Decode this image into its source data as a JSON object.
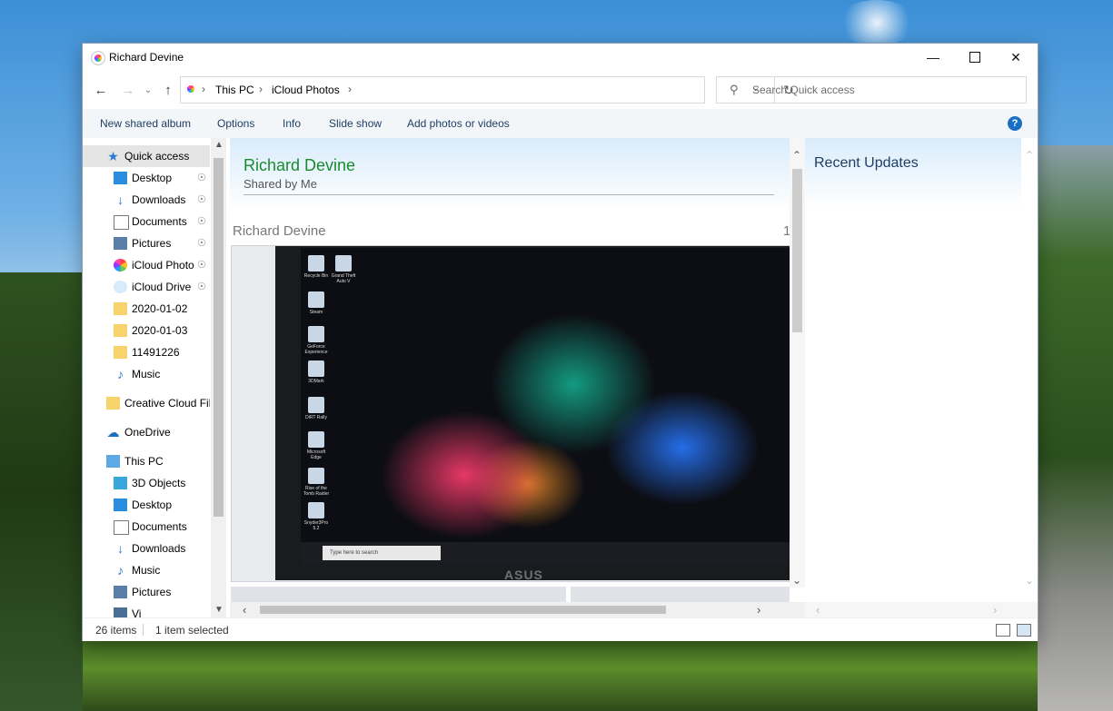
{
  "window": {
    "title": "Richard Devine"
  },
  "address": {
    "crumbs": [
      "This PC",
      "iCloud Photos"
    ],
    "search_placeholder": "Search Quick access"
  },
  "toolbar": {
    "items": [
      "New shared album",
      "Options",
      "Info",
      "Slide show",
      "Add photos or videos"
    ],
    "help": "?"
  },
  "nav": {
    "items": [
      {
        "label": "Quick access",
        "icon": "star-icon",
        "pinned": false,
        "level": 0
      },
      {
        "label": "Desktop",
        "icon": "desktop-icon",
        "pinned": true,
        "level": 1
      },
      {
        "label": "Downloads",
        "icon": "download-icon",
        "pinned": true,
        "level": 1
      },
      {
        "label": "Documents",
        "icon": "document-icon",
        "pinned": true,
        "level": 1
      },
      {
        "label": "Pictures",
        "icon": "pictures-icon",
        "pinned": true,
        "level": 1
      },
      {
        "label": "iCloud Photo",
        "icon": "icloud-photos-icon",
        "pinned": true,
        "level": 1
      },
      {
        "label": "iCloud Drive",
        "icon": "icloud-drive-icon",
        "pinned": true,
        "level": 1
      },
      {
        "label": "2020-01-02",
        "icon": "folder-icon",
        "pinned": false,
        "level": 1
      },
      {
        "label": "2020-01-03",
        "icon": "folder-icon",
        "pinned": false,
        "level": 1
      },
      {
        "label": "11491226",
        "icon": "folder-icon",
        "pinned": false,
        "level": 1
      },
      {
        "label": "Music",
        "icon": "music-icon",
        "pinned": false,
        "level": 1
      },
      {
        "label": "Creative Cloud Fil",
        "icon": "creative-cloud-icon",
        "pinned": false,
        "level": 0
      },
      {
        "label": "OneDrive",
        "icon": "onedrive-icon",
        "pinned": false,
        "level": 0
      },
      {
        "label": "This PC",
        "icon": "computer-icon",
        "pinned": false,
        "level": 0
      },
      {
        "label": "3D Objects",
        "icon": "cube-icon",
        "pinned": false,
        "level": 1
      },
      {
        "label": "Desktop",
        "icon": "desktop-icon",
        "pinned": false,
        "level": 1
      },
      {
        "label": "Documents",
        "icon": "document-icon",
        "pinned": false,
        "level": 1
      },
      {
        "label": "Downloads",
        "icon": "download-icon",
        "pinned": false,
        "level": 1
      },
      {
        "label": "Music",
        "icon": "music-icon",
        "pinned": false,
        "level": 1
      },
      {
        "label": "Pictures",
        "icon": "pictures-icon",
        "pinned": false,
        "level": 1
      },
      {
        "label": "Vi",
        "icon": "video-icon",
        "pinned": false,
        "level": 1
      }
    ]
  },
  "album": {
    "title": "Richard Devine",
    "subtitle": "Shared by Me",
    "section": "Richard Devine",
    "count": "1"
  },
  "photo": {
    "search_text": "Type here to search",
    "brand": "ASUS",
    "desktop_icons": [
      "Recycle Bin",
      "Grand Theft Auto V",
      "Steam",
      "GeForce Experience",
      "3DMark",
      "DiRT Rally",
      "Microsoft Edge",
      "Rise of the Tomb Raider",
      "Snyder3Pro 5.2"
    ]
  },
  "right_panel": {
    "title": "Recent Updates"
  },
  "status": {
    "count": "26 items",
    "selected": "1 item selected"
  },
  "colors": {
    "album_title": "#1b8a2f",
    "accent": "#1a6fc4"
  }
}
